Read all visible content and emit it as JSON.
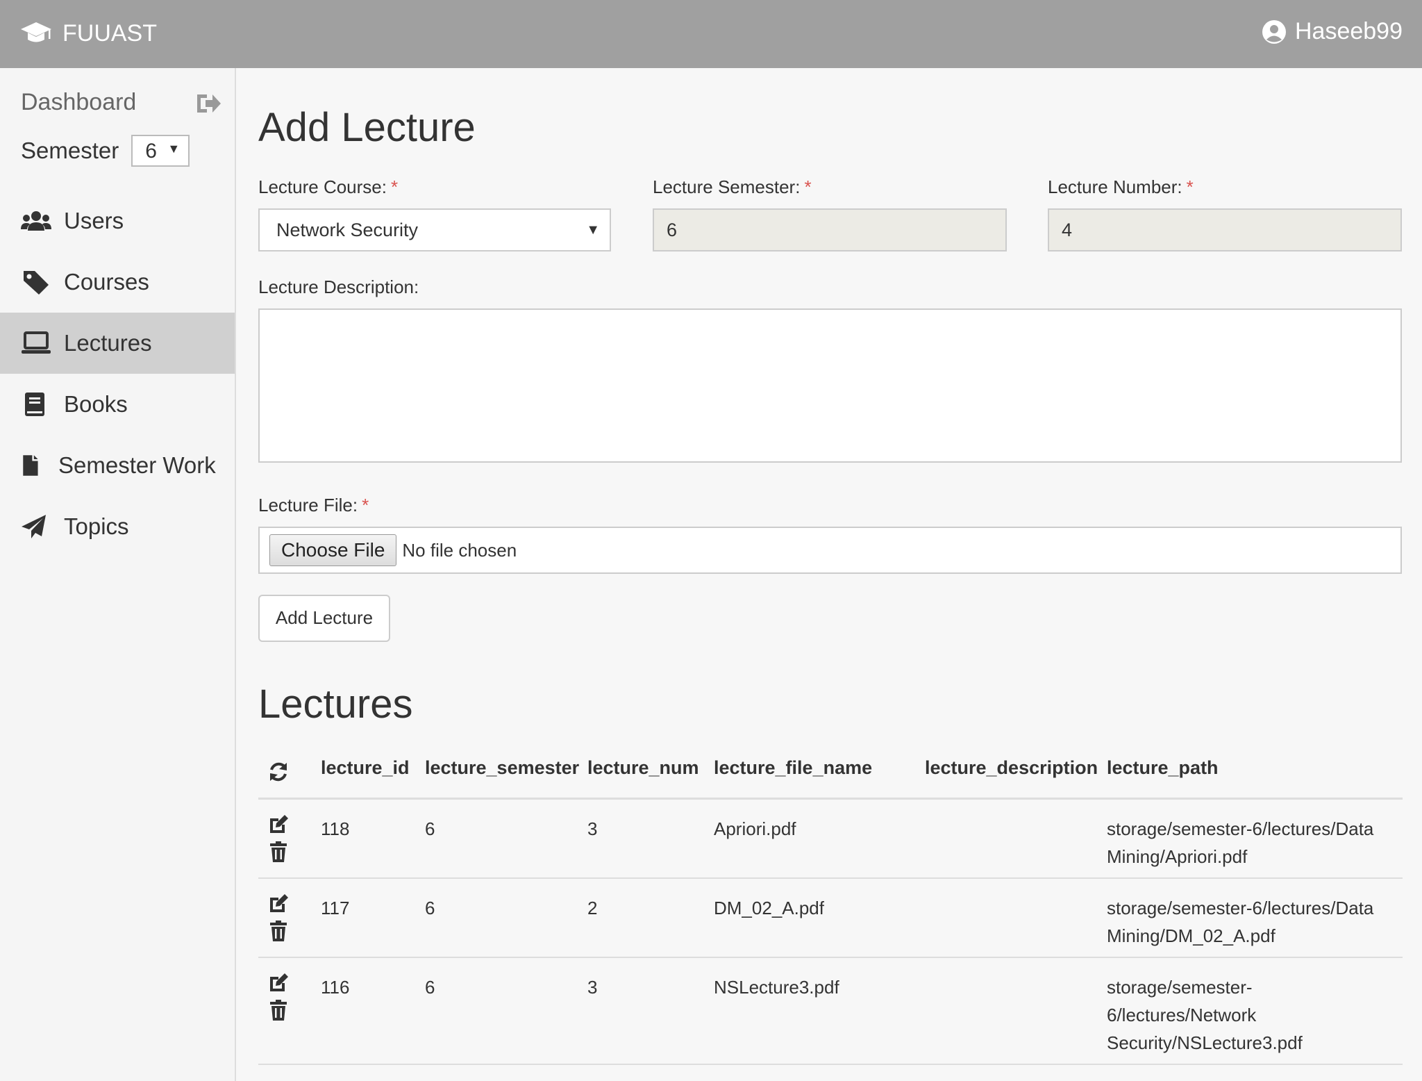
{
  "topbar": {
    "brand": "FUUAST",
    "user": "Haseeb99"
  },
  "sidebar": {
    "dashboard_label": "Dashboard",
    "semester_label": "Semester",
    "semester_value": "6",
    "items": [
      {
        "label": "Users",
        "icon": "users-icon"
      },
      {
        "label": "Courses",
        "icon": "tag-icon"
      },
      {
        "label": "Lectures",
        "icon": "laptop-icon",
        "active": true
      },
      {
        "label": "Books",
        "icon": "book-icon"
      },
      {
        "label": "Semester Work",
        "icon": "file-icon"
      },
      {
        "label": "Topics",
        "icon": "paper-plane-icon"
      }
    ]
  },
  "form": {
    "title": "Add Lecture",
    "course_label": "Lecture Course:",
    "course_value": "Network Security",
    "semester_label": "Lecture Semester:",
    "semester_value": "6",
    "number_label": "Lecture Number:",
    "number_value": "4",
    "description_label": "Lecture Description:",
    "description_value": "",
    "file_label": "Lecture File:",
    "file_button": "Choose File",
    "file_status": "No file chosen",
    "required_mark": "*",
    "submit_label": "Add Lecture"
  },
  "table": {
    "title": "Lectures",
    "columns": [
      "lecture_id",
      "lecture_semester",
      "lecture_num",
      "lecture_file_name",
      "lecture_description",
      "lecture_path"
    ],
    "rows": [
      {
        "id": "118",
        "semester": "6",
        "num": "3",
        "file_name": "Apriori.pdf",
        "description": "",
        "path": "storage/semester-6/lectures/Data Mining/Apriori.pdf"
      },
      {
        "id": "117",
        "semester": "6",
        "num": "2",
        "file_name": "DM_02_A.pdf",
        "description": "",
        "path": "storage/semester-6/lectures/Data Mining/DM_02_A.pdf"
      },
      {
        "id": "116",
        "semester": "6",
        "num": "3",
        "file_name": "NSLecture3.pdf",
        "description": "",
        "path": "storage/semester-6/lectures/Network Security/NSLecture3.pdf"
      }
    ]
  }
}
